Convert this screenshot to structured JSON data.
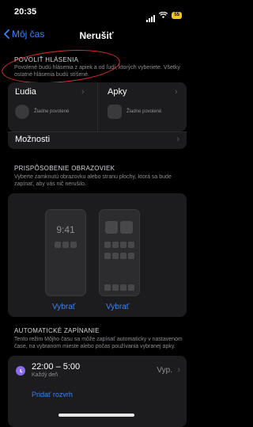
{
  "status_bar": {
    "time": "20:35",
    "battery": "55"
  },
  "nav": {
    "back_label": "Môj čas",
    "title": "Nerušiť"
  },
  "allow_notifications": {
    "header": "POVOLIŤ HLÁSENIA",
    "description": "Povolené budú hlásenia z apiek a od ľudí, ktorých vyberiete. Všetky ostatné hlásenia budú stíšené.",
    "people": {
      "title": "Ľudia",
      "none": "Žiadne povolené"
    },
    "apps": {
      "title": "Apky",
      "none": "Žiadne povolené"
    },
    "options_label": "Možnosti"
  },
  "screens": {
    "header": "PRISPÔSOBENIE OBRAZOVIEK",
    "description": "Vyberte zamknutú obrazovku alebo stranu plochy, ktorá sa bude zapínať, aby vás nič nerušilo.",
    "lock_time": "9:41",
    "choose_lock": "Vybrať",
    "choose_home": "Vybrať"
  },
  "automatic": {
    "header": "AUTOMATICKÉ ZAPÍNANIE",
    "description": "Tento režim Môjho času sa môže zapínať automaticky v nastavenom čase, na vybranom mieste alebo počas používania vybranej apky.",
    "schedule": {
      "time": "22:00 – 5:00",
      "days": "Každý deň",
      "state": "Vyp."
    },
    "add_label": "Pridať rozvrh"
  },
  "colors": {
    "accent": "#3b82f6",
    "annotation": "#e0322b",
    "schedule_icon": "#8b6cf0"
  }
}
